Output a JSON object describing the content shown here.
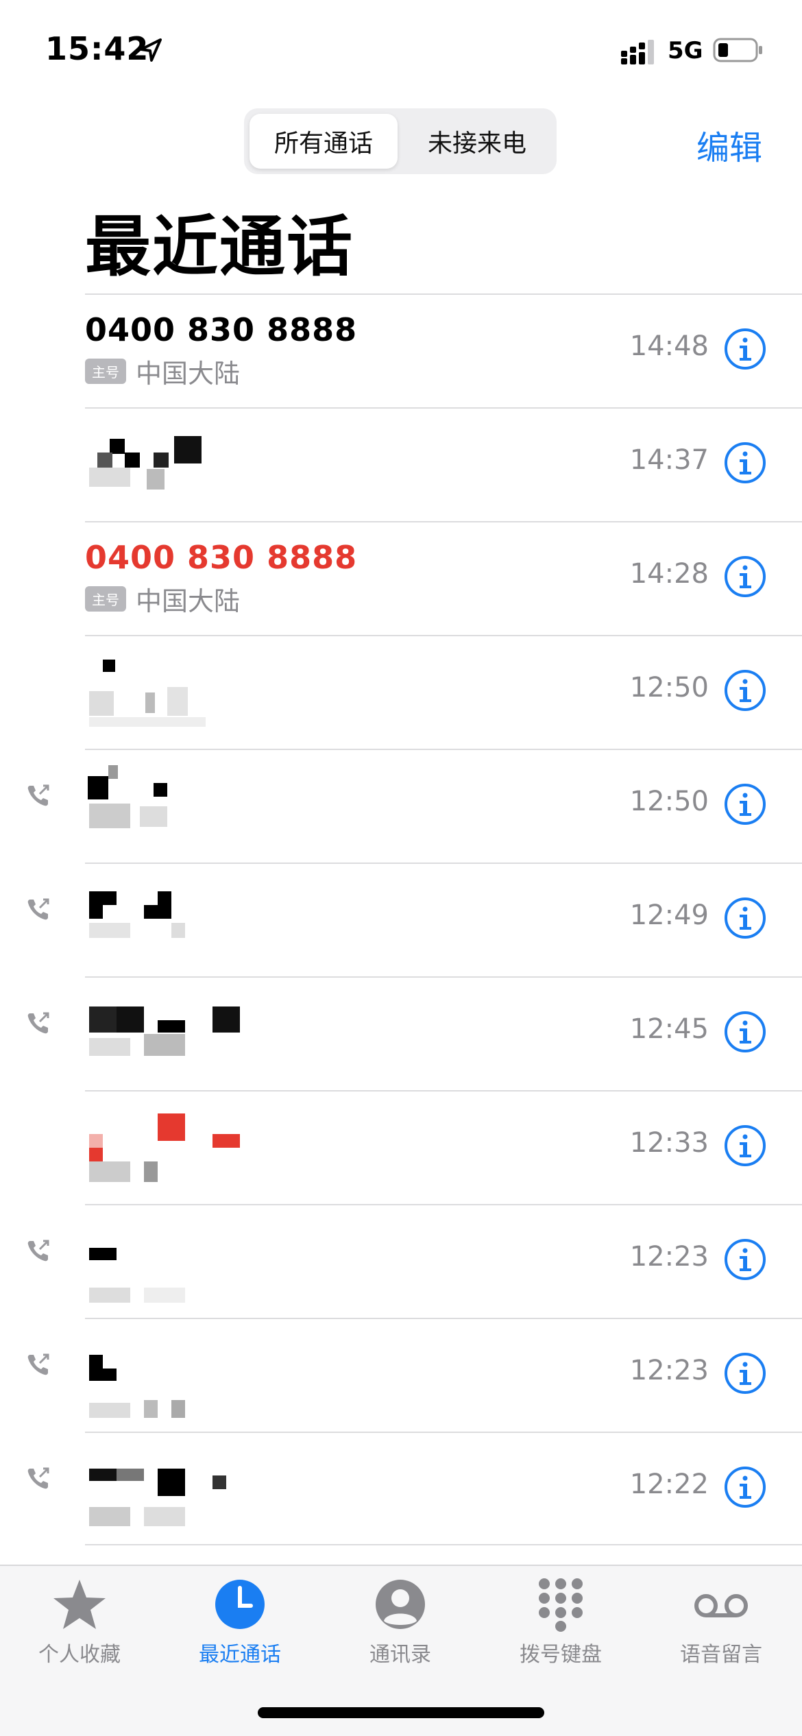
{
  "status_bar": {
    "time": "15:42",
    "network": "5G",
    "location_icon": "location-arrow-icon",
    "signal_icon": "signal-icon",
    "battery_icon": "battery-icon"
  },
  "header": {
    "segments": [
      "所有通话",
      "未接来电"
    ],
    "selected_segment": "所有通话",
    "edit_label": "编辑",
    "title": "最近通话"
  },
  "calls": [
    {
      "name": "0400 830 8888",
      "badge": "主号",
      "location": "中国大陆",
      "time": "14:48",
      "missed": false,
      "outgoing": false
    },
    {
      "name": "",
      "badge": "",
      "location": "",
      "time": "14:37",
      "missed": false,
      "outgoing": false,
      "redacted": true
    },
    {
      "name": "0400 830 8888",
      "badge": "主号",
      "location": "中国大陆",
      "time": "14:28",
      "missed": true,
      "outgoing": false
    },
    {
      "name": "",
      "badge": "",
      "location": "",
      "time": "12:50",
      "missed": false,
      "outgoing": false,
      "redacted": true
    },
    {
      "name": "",
      "badge": "",
      "location": "",
      "time": "12:50",
      "missed": false,
      "outgoing": true,
      "redacted": true
    },
    {
      "name": "",
      "badge": "",
      "location": "",
      "time": "12:49",
      "missed": false,
      "outgoing": true,
      "redacted": true
    },
    {
      "name": "",
      "badge": "",
      "location": "",
      "time": "12:45",
      "missed": false,
      "outgoing": true,
      "redacted": true
    },
    {
      "name": "",
      "badge": "",
      "location": "",
      "time": "12:33",
      "missed": true,
      "outgoing": false,
      "redacted": true
    },
    {
      "name": "",
      "badge": "",
      "location": "",
      "time": "12:23",
      "missed": false,
      "outgoing": true,
      "redacted": true
    },
    {
      "name": "",
      "badge": "",
      "location": "",
      "time": "12:23",
      "missed": false,
      "outgoing": true,
      "redacted": true
    },
    {
      "name": "",
      "badge": "",
      "location": "",
      "time": "12:22",
      "missed": false,
      "outgoing": true,
      "redacted": true
    }
  ],
  "tab_bar": {
    "tabs": [
      {
        "label": "个人收藏",
        "icon": "star-icon"
      },
      {
        "label": "最近通话",
        "icon": "clock-icon"
      },
      {
        "label": "通讯录",
        "icon": "person-icon"
      },
      {
        "label": "拨号键盘",
        "icon": "keypad-icon"
      },
      {
        "label": "语音留言",
        "icon": "voicemail-icon"
      }
    ],
    "active": "最近通话"
  },
  "colors": {
    "accent": "#1a7ef2",
    "missed": "#e5392f",
    "secondary_text": "#8a8a8e"
  }
}
